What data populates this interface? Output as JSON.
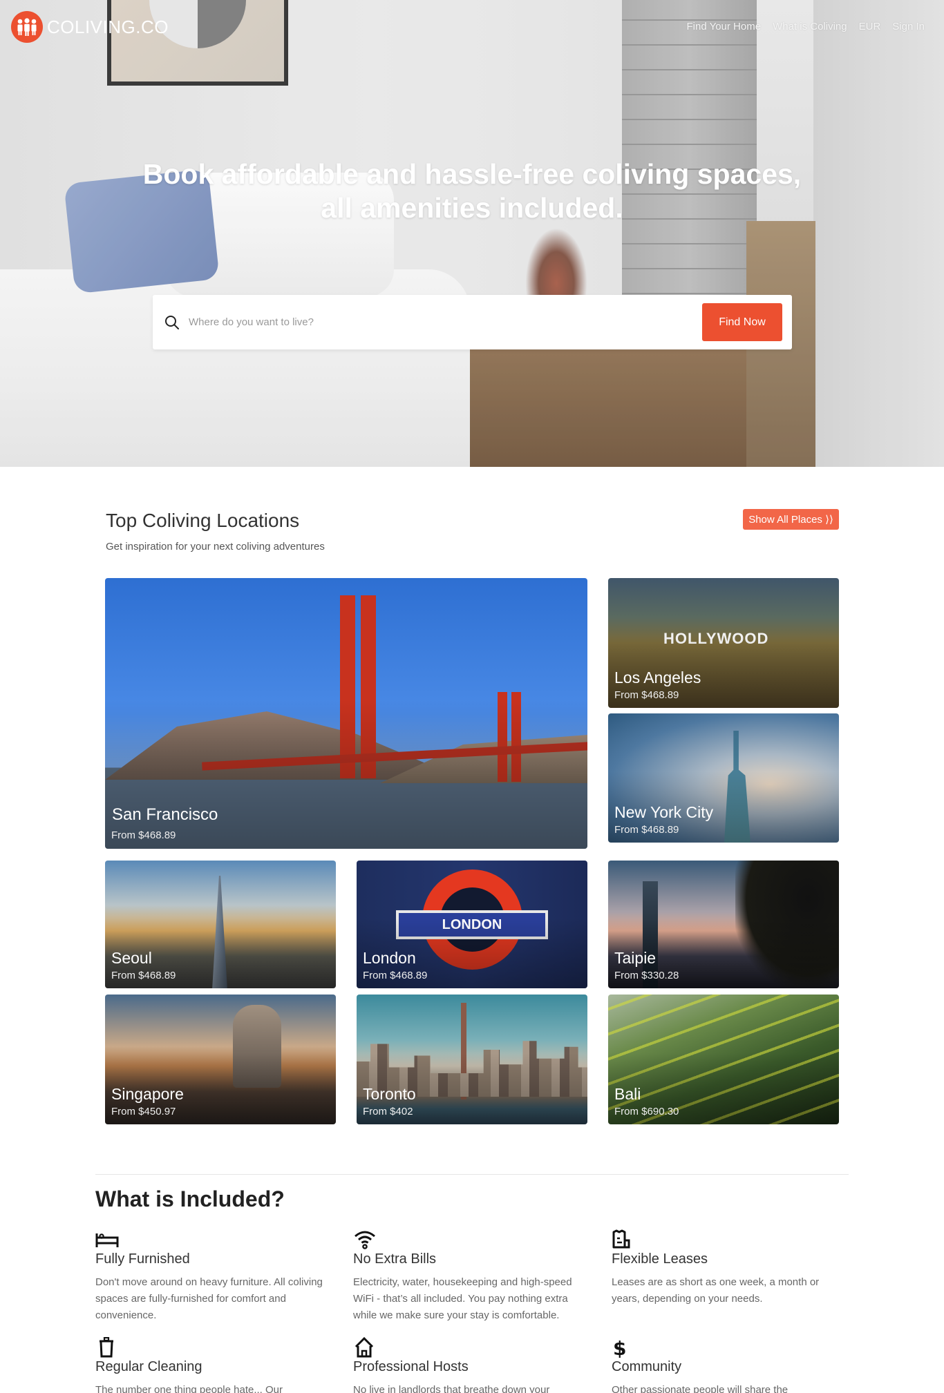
{
  "brand": {
    "name": "COLIVING.CO",
    "accent_color": "#ec5030"
  },
  "nav": {
    "items": [
      {
        "label": "Find Your Home"
      },
      {
        "label": "What is Coliving"
      },
      {
        "label": "EUR"
      },
      {
        "label": "Sign In"
      }
    ]
  },
  "hero": {
    "title": "Book affordable and hassle-free coliving spaces, all amenities included.",
    "search": {
      "placeholder": "Where do you want to live?",
      "value": "",
      "button_label": "Find Now",
      "icon": "search-icon"
    }
  },
  "locations": {
    "title": "Top Coliving Locations",
    "subtitle": "Get inspiration for your next coliving adventures",
    "show_all_label": "Show All Places ⟩⟩",
    "cards": [
      {
        "city": "San Francisco",
        "price": "From $468.89",
        "sign_text": ""
      },
      {
        "city": "Los Angeles",
        "price": "From $468.89",
        "sign_text": "HOLLYWOOD"
      },
      {
        "city": "New York City",
        "price": "From $468.89"
      },
      {
        "city": "Seoul",
        "price": "From $468.89"
      },
      {
        "city": "London",
        "price": "From $468.89",
        "sign_text": "LONDON"
      },
      {
        "city": "Taipie",
        "price": "From $330.28"
      },
      {
        "city": "Singapore",
        "price": "From $450.97"
      },
      {
        "city": "Toronto",
        "price": "From $402"
      },
      {
        "city": "Bali",
        "price": "From $690.30"
      }
    ]
  },
  "included": {
    "title": "What is Included?",
    "features": [
      {
        "icon": "bed-icon",
        "name": "Fully Furnished",
        "desc": "Don't move around on heavy furniture. All coliving spaces are fully-furnished for comfort and convenience."
      },
      {
        "icon": "wifi-icon",
        "name": "No Extra Bills",
        "desc": "Electricity, water, housekeeping and high-speed WiFi - that’s all included. You pay nothing extra while we make sure your stay is comfortable."
      },
      {
        "icon": "receipt-icon",
        "name": "Flexible Leases",
        "desc": "Leases are as short as one week, a month or years, depending on your needs."
      },
      {
        "icon": "trash-icon",
        "name": "Regular Cleaning",
        "desc": "The number one thing people hate... Our"
      },
      {
        "icon": "house-icon",
        "name": "Professional Hosts",
        "desc": "No live in landlords that breathe down your"
      },
      {
        "icon": "dollar-icon",
        "name": "Community",
        "desc": "Other passionate people will share the"
      }
    ]
  }
}
